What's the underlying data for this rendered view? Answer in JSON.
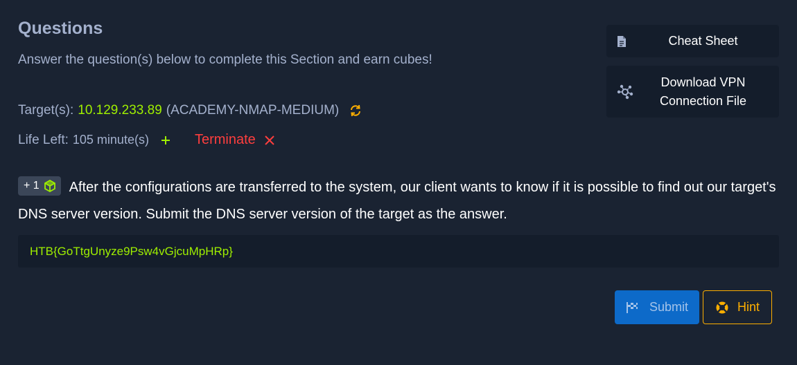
{
  "header": {
    "title": "Questions",
    "subtitle": "Answer the question(s) below to complete this Section and earn cubes!"
  },
  "target": {
    "label": "Target(s):",
    "ip": "10.129.233.89",
    "name": "(ACADEMY-NMAP-MEDIUM)",
    "reset_icon": "refresh-icon"
  },
  "life": {
    "label": "Life Left:",
    "value": "105 minute(s)",
    "extend_icon": "plus-icon",
    "terminate_label": "Terminate",
    "terminate_icon": "x-icon"
  },
  "sidebar": {
    "cheat_sheet_label": "Cheat Sheet",
    "cheat_sheet_icon": "document-icon",
    "vpn_line1": "Download VPN",
    "vpn_line2": "Connection File",
    "vpn_icon": "network-icon"
  },
  "question": {
    "badge_text": "+ 1",
    "badge_icon": "cube-icon",
    "text": "After the configurations are transferred to the system, our client wants to know if it is possible to find out our target's DNS server version. Submit the DNS server version of the target as the answer."
  },
  "answer": {
    "value": "HTB{GoTtgUnyze9Psw4vGjcuMpHRp}"
  },
  "actions": {
    "submit_label": "Submit",
    "submit_icon": "flag-icon",
    "hint_label": "Hint",
    "hint_icon": "lifebuoy-icon"
  },
  "colors": {
    "background": "#1a2332",
    "panel": "#141d2b",
    "accent_green": "#9fef00",
    "danger": "#ff3e3e",
    "primary": "#0d6ac9",
    "warning": "#ffaf00",
    "muted_text": "#a4b1cd"
  }
}
